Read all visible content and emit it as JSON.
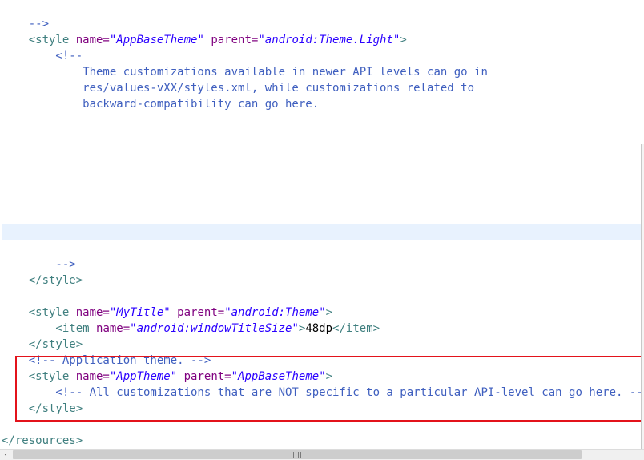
{
  "editor": {
    "lines": [
      {
        "id": "l1",
        "segments": [
          {
            "t": "com",
            "v": "    -->"
          }
        ]
      },
      {
        "id": "l2",
        "segments": [
          {
            "t": "tag",
            "v": "    <style "
          },
          {
            "t": "attr",
            "v": "name="
          },
          {
            "t": "val",
            "v": "\"AppBaseTheme\""
          },
          {
            "t": "tag",
            "v": " "
          },
          {
            "t": "attr",
            "v": "parent="
          },
          {
            "t": "val",
            "v": "\"android:Theme.Light\""
          },
          {
            "t": "tag",
            "v": ">"
          }
        ]
      },
      {
        "id": "l3",
        "segments": [
          {
            "t": "com",
            "v": "        <!--"
          }
        ]
      },
      {
        "id": "l4",
        "segments": [
          {
            "t": "com",
            "v": "            Theme customizations available in newer API levels can go in"
          }
        ]
      },
      {
        "id": "l5",
        "segments": [
          {
            "t": "com",
            "v": "            res/values-vXX/styles.xml, while customizations related to"
          }
        ]
      },
      {
        "id": "l6",
        "segments": [
          {
            "t": "com",
            "v": "            backward-compatibility can go here."
          }
        ]
      },
      {
        "id": "l7",
        "segments": [
          {
            "t": "com",
            "v": ""
          }
        ]
      },
      {
        "id": "l8",
        "segments": [
          {
            "t": "com",
            "v": ""
          }
        ]
      },
      {
        "id": "l9",
        "segments": [
          {
            "t": "com",
            "v": ""
          }
        ]
      },
      {
        "id": "l10",
        "segments": [
          {
            "t": "com",
            "v": ""
          }
        ]
      },
      {
        "id": "l11",
        "segments": [
          {
            "t": "com",
            "v": ""
          }
        ]
      },
      {
        "id": "l12",
        "segments": [
          {
            "t": "com",
            "v": ""
          }
        ]
      },
      {
        "id": "l13",
        "segments": [
          {
            "t": "com",
            "v": ""
          }
        ]
      },
      {
        "id": "l14",
        "segments": [
          {
            "t": "com",
            "v": ""
          }
        ]
      },
      {
        "id": "l15",
        "segments": [
          {
            "t": "com",
            "v": ""
          }
        ]
      },
      {
        "id": "l16",
        "segments": [
          {
            "t": "com",
            "v": "        -->"
          }
        ]
      },
      {
        "id": "l17",
        "segments": [
          {
            "t": "tag",
            "v": "    </style>"
          }
        ]
      },
      {
        "id": "l18",
        "segments": [
          {
            "t": "text",
            "v": ""
          }
        ]
      },
      {
        "id": "l19",
        "segments": [
          {
            "t": "tag",
            "v": "    <style "
          },
          {
            "t": "attr",
            "v": "name="
          },
          {
            "t": "val",
            "v": "\"MyTitle\""
          },
          {
            "t": "tag",
            "v": " "
          },
          {
            "t": "attr",
            "v": "parent="
          },
          {
            "t": "val",
            "v": "\"android:Theme\""
          },
          {
            "t": "tag",
            "v": ">"
          }
        ]
      },
      {
        "id": "l20",
        "segments": [
          {
            "t": "tag",
            "v": "        <item "
          },
          {
            "t": "attr",
            "v": "name="
          },
          {
            "t": "val",
            "v": "\"android:windowTitleSize\""
          },
          {
            "t": "tag",
            "v": ">"
          },
          {
            "t": "text",
            "v": "48dp"
          },
          {
            "t": "tag",
            "v": "</item>"
          }
        ]
      },
      {
        "id": "l21",
        "segments": [
          {
            "t": "tag",
            "v": "    </style>"
          }
        ]
      },
      {
        "id": "l22",
        "segments": [
          {
            "t": "com",
            "v": "    <!-- Application theme. -->"
          }
        ]
      },
      {
        "id": "l23",
        "segments": [
          {
            "t": "tag",
            "v": "    <style "
          },
          {
            "t": "attr",
            "v": "name="
          },
          {
            "t": "val",
            "v": "\"AppTheme\""
          },
          {
            "t": "tag",
            "v": " "
          },
          {
            "t": "attr",
            "v": "parent="
          },
          {
            "t": "val",
            "v": "\"AppBaseTheme\""
          },
          {
            "t": "tag",
            "v": ">"
          }
        ]
      },
      {
        "id": "l24",
        "segments": [
          {
            "t": "com",
            "v": "        <!-- All customizations that are NOT specific to a particular API-level can go here. -->"
          }
        ]
      },
      {
        "id": "l25",
        "segments": [
          {
            "t": "tag",
            "v": "    </style>"
          }
        ]
      },
      {
        "id": "l26",
        "segments": [
          {
            "t": "text",
            "v": ""
          }
        ]
      },
      {
        "id": "l27",
        "segments": [
          {
            "t": "tag",
            "v": "</resources>"
          }
        ]
      }
    ]
  },
  "scrollbar": {
    "left_arrow_icon": "‹",
    "grip_icon": "grip-lines-icon"
  },
  "colors": {
    "tag": "#3f7f7f",
    "attr": "#7f007f",
    "value": "#2a00ff",
    "comment": "#3f5fbf",
    "highlight_box": "#e3131b",
    "current_line": "#e8f2fe"
  }
}
